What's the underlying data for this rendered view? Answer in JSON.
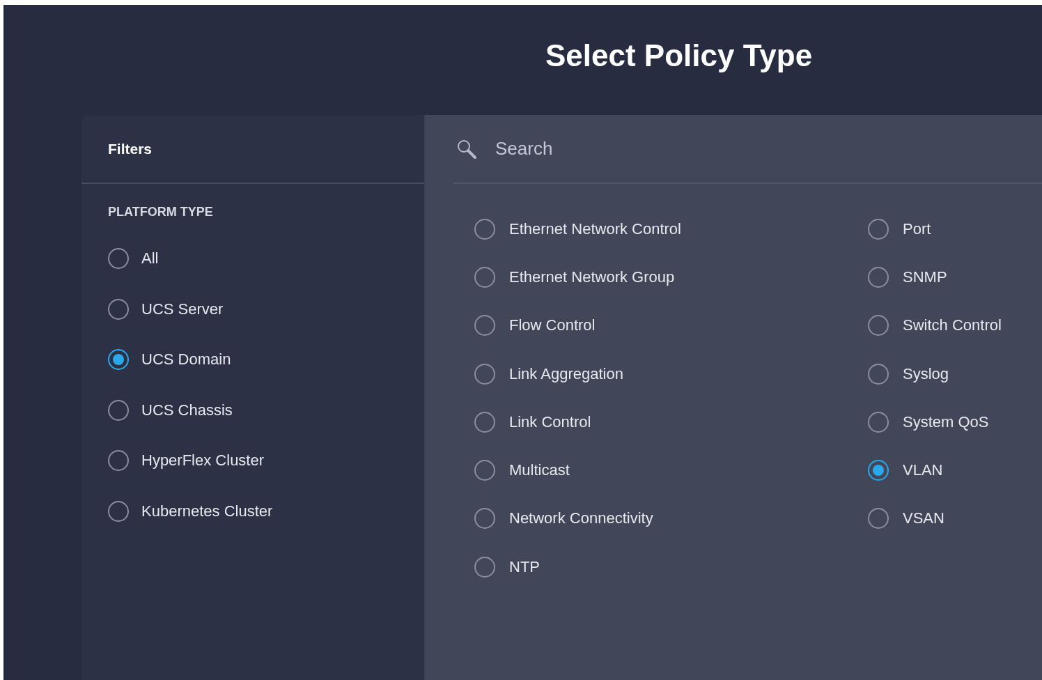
{
  "title": "Select Policy Type",
  "filters": {
    "heading": "Filters",
    "section_label": "PLATFORM TYPE",
    "options": [
      {
        "label": "All",
        "selected": false
      },
      {
        "label": "UCS Server",
        "selected": false
      },
      {
        "label": "UCS Domain",
        "selected": true
      },
      {
        "label": "UCS Chassis",
        "selected": false
      },
      {
        "label": "HyperFlex Cluster",
        "selected": false
      },
      {
        "label": "Kubernetes Cluster",
        "selected": false
      }
    ]
  },
  "search": {
    "placeholder": "Search"
  },
  "policy_columns": [
    {
      "items": [
        {
          "label": "Ethernet Network Control",
          "selected": false
        },
        {
          "label": "Ethernet Network Group",
          "selected": false
        },
        {
          "label": "Flow Control",
          "selected": false
        },
        {
          "label": "Link Aggregation",
          "selected": false
        },
        {
          "label": "Link Control",
          "selected": false
        },
        {
          "label": "Multicast",
          "selected": false
        },
        {
          "label": "Network Connectivity",
          "selected": false
        },
        {
          "label": "NTP",
          "selected": false
        }
      ]
    },
    {
      "items": [
        {
          "label": "Port",
          "selected": false
        },
        {
          "label": "SNMP",
          "selected": false
        },
        {
          "label": "Switch Control",
          "selected": false
        },
        {
          "label": "Syslog",
          "selected": false
        },
        {
          "label": "System QoS",
          "selected": false
        },
        {
          "label": "VLAN",
          "selected": true
        },
        {
          "label": "VSAN",
          "selected": false
        }
      ]
    }
  ]
}
